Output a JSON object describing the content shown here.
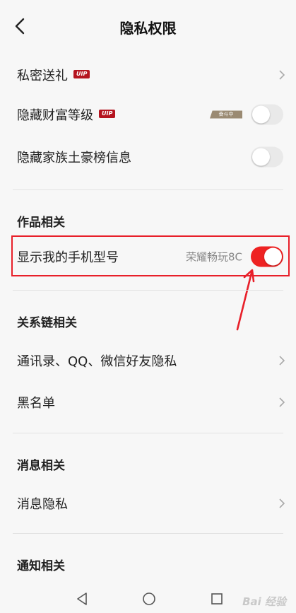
{
  "header": {
    "title": "隐私权限"
  },
  "rows": {
    "private_gift": {
      "label": "私密送礼",
      "badge": "UIP"
    },
    "hide_wealth": {
      "label": "隐藏财富等级",
      "badge": "UIP",
      "tag": "奋斗中"
    },
    "hide_family": {
      "label": "隐藏家族土豪榜信息"
    }
  },
  "sections": {
    "works": "作品相关",
    "relation": "关系链相关",
    "message": "消息相关",
    "notify": "通知相关"
  },
  "phone_row": {
    "label": "显示我的手机型号",
    "value": "荣耀畅玩8C"
  },
  "relation_rows": {
    "contacts": "通讯录、QQ、微信好友隐私",
    "blacklist": "黑名单"
  },
  "message_rows": {
    "privacy": "消息隐私"
  },
  "watermark": "Bai 经验",
  "colors": {
    "accent": "#ee2222",
    "annotation": "#e8202a"
  }
}
